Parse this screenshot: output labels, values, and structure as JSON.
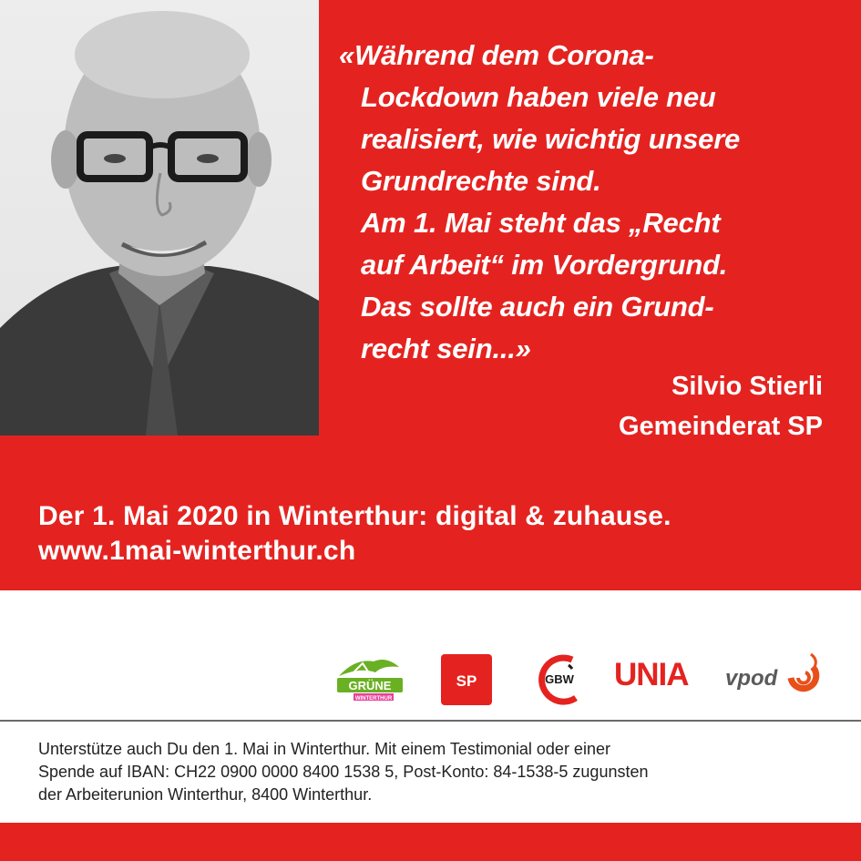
{
  "colors": {
    "brand_red": "#e42320",
    "text_white": "#ffffff",
    "footer_text": "#222222",
    "gruene_green": "#6ab023",
    "gbw_red": "#e42320",
    "unia_red": "#e42320",
    "vpod_gray": "#5a5a5a",
    "vpod_accent": "#e8501a"
  },
  "photo": {
    "icon": "portrait-photo"
  },
  "quote": {
    "lines": [
      "«Während dem Corona-",
      "Lockdown haben viele neu",
      "realisiert, wie wichtig unsere",
      "Grundrechte sind.",
      "Am 1. Mai steht das „Recht",
      "auf Arbeit“ im Vordergrund.",
      "Das sollte auch ein Grund-",
      "recht sein...»"
    ]
  },
  "author": {
    "name": "Silvio Stierli",
    "role": "Gemeinderat SP"
  },
  "event": {
    "headline": "Der 1. Mai 2020 in Winterthur: digital & zuhause.",
    "url": "www.1mai-winterthur.ch"
  },
  "logos": {
    "gruene": {
      "icon": "gruene-logo",
      "name": "GRÜNE",
      "sub": "WINTERTHUR"
    },
    "sp": {
      "icon": "sp-logo",
      "name": "SP"
    },
    "gbw": {
      "icon": "gbw-logo",
      "name": "GBW"
    },
    "unia": {
      "icon": "unia-logo",
      "name": "UNIA"
    },
    "vpod": {
      "icon": "vpod-logo",
      "name": "vpod"
    }
  },
  "footer": {
    "lines": [
      "Unterstütze auch Du den 1. Mai in Winterthur. Mit einem Testimonial oder einer",
      "Spende auf IBAN: CH22 0900 0000 8400 1538 5, Post-Konto: 84-1538-5 zugunsten",
      "der Arbeiterunion Winterthur, 8400 Winterthur."
    ]
  }
}
